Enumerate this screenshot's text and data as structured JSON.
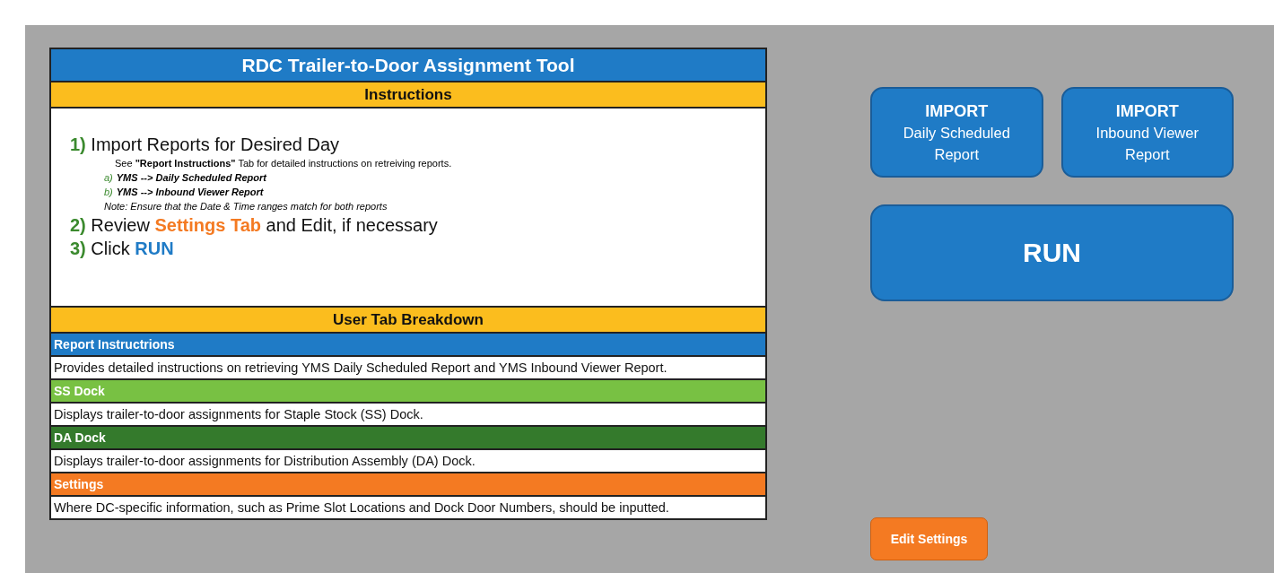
{
  "panel": {
    "title": "RDC Trailer-to-Door Assignment Tool",
    "instructions_heading": "Instructions",
    "steps": [
      {
        "number": "1)",
        "parts": [
          {
            "kind": "plain",
            "text": "Import Reports for Desired Day"
          }
        ],
        "details": [
          {
            "kind": "text",
            "text": "See **\"Report Instructions\"** Tab for detailed instructions on retreiving reports."
          },
          {
            "kind": "option",
            "letter": "a)",
            "text": "YMS --> Daily Scheduled Report"
          },
          {
            "kind": "option",
            "letter": "b)",
            "text": "YMS --> Inbound Viewer Report"
          },
          {
            "kind": "note",
            "text": "Note: Ensure that the Date & Time ranges match for both reports"
          }
        ]
      },
      {
        "number": "2)",
        "parts": [
          {
            "kind": "plain",
            "text": "Review "
          },
          {
            "kind": "orange",
            "text": "Settings Tab"
          },
          {
            "kind": "plain",
            "text": " and Edit, if necessary"
          }
        ]
      },
      {
        "number": "3)",
        "parts": [
          {
            "kind": "plain",
            "text": "Click "
          },
          {
            "kind": "blue",
            "text": "RUN"
          }
        ]
      }
    ],
    "breakdown_heading": "User Tab Breakdown",
    "tabs": [
      {
        "title": "Report Instructrions",
        "color": "#1f7bc6",
        "description": "Provides detailed instructions on retrieving YMS Daily Scheduled Report and YMS Inbound Viewer Report."
      },
      {
        "title": "SS Dock",
        "color": "#78c143",
        "description": "Displays trailer-to-door assignments for Staple Stock (SS) Dock."
      },
      {
        "title": "DA Dock",
        "color": "#347a2c",
        "description": "Displays trailer-to-door assignments for Distribution Assembly (DA) Dock."
      },
      {
        "title": "Settings",
        "color": "#f47a22",
        "description": "Where DC-specific information, such as Prime Slot Locations and Dock Door Numbers, should be inputted."
      }
    ]
  },
  "import_buttons": [
    {
      "title": "IMPORT",
      "subtitle": "Daily Scheduled Report"
    },
    {
      "title": "IMPORT",
      "subtitle": "Inbound Viewer Report"
    }
  ],
  "run_button": "RUN",
  "edit_settings_button": "Edit Settings"
}
